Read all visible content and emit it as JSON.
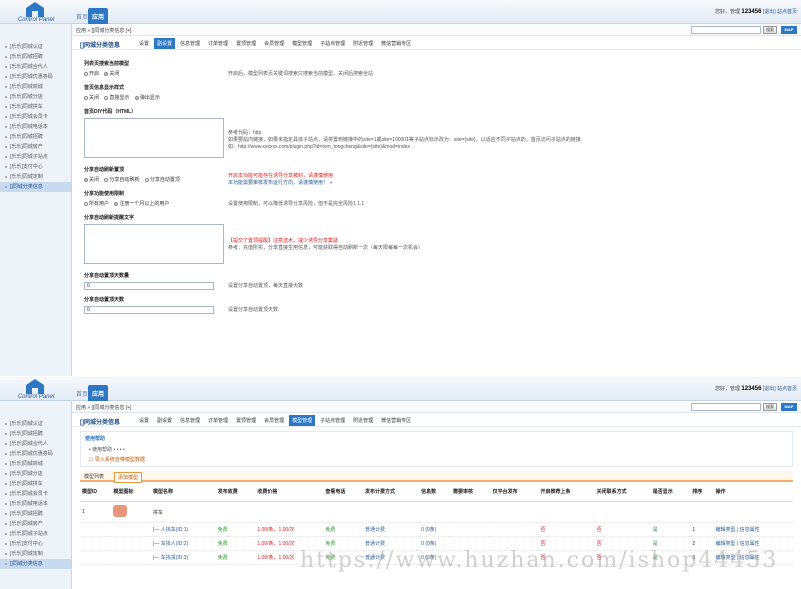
{
  "header": {
    "logo_text": "Control Panel",
    "tabs": [
      "首页",
      "应用"
    ],
    "user_prefix": "您好，管理",
    "user_name": "123456",
    "logout": "[退出]",
    "site_home": "站点首页"
  },
  "sidebar": {
    "items": [
      "[乐乐]同城认证",
      "[乐乐]同城招聘",
      "[乐乐]同城合代人",
      "[乐乐]同城优惠劵码",
      "[乐乐]同城商城",
      "[乐乐]同城分店",
      "[乐乐]同城拼车",
      "[乐乐]同城会员卡",
      "[乐乐]同城电话本",
      "[乐乐]同城招聘",
      "[乐乐]同城房产",
      "[乐乐]同城子站点",
      "[乐乐]支付中心",
      "[乐乐]同城定制",
      "[]同城分类信息"
    ],
    "active_index": 14
  },
  "breadcrumb": "应用 » []同城分类信息 [+]",
  "search": {
    "button": "搜索",
    "map": "MAP"
  },
  "subnav": {
    "title": "[]同城分类信息",
    "items": [
      "设置",
      "副设置",
      "信息管理",
      "订单管理",
      "置顶管理",
      "会员管理",
      "模型管理",
      "子站点管理",
      "附近管理",
      "微信营销专区"
    ]
  },
  "panel1": {
    "subnav_active": 1,
    "fields": [
      {
        "label": "列表页搜索当前模型",
        "options": [
          "开启",
          "关闭"
        ],
        "selected": 1,
        "tip": "开启后，模型列表页关键词搜索只搜索当前模型，关闭后搜索全站"
      },
      {
        "label": "首页信息显示样式",
        "options": [
          "关闭",
          "直接显示",
          "弹出显示"
        ],
        "selected": 2
      }
    ],
    "diy_label": "首页DIY代码（HTML）",
    "diy_tips": [
      "参考代码：http",
      "如果要站内链接，如果未指定具体子站点，请将置到链接中的site=1或site=100001等子站点标示改为：site={site}，以适应不同子站点的，首页访问子站点的链接",
      "如：http://www.xxxxxx.com/plugin.php?id=tom_tongcheng&site={site}&mod=index"
    ],
    "share_label": "分享自动刷新置顶",
    "share_options": [
      "关闭",
      "分享自动刷新",
      "分享自动置顶"
    ],
    "share_selected": 0,
    "share_tip_red": "开启本功能可能存在诱导分享被封，请谨慎使用",
    "share_tip_blue": "本功能需要审核发布运行方向，请谨慎使用！ »",
    "limit_label": "分享功能使用限制",
    "limit_options": [
      "所有用户",
      "注册一个月以上的用户"
    ],
    "limit_selected": 1,
    "limit_tip": "设置使用限制，可以降低诱导分享风险，但不是完全风险1.1.1",
    "remind_label": "分享自动刷新提醒文字",
    "remind_tip_red": "【提交了置顶提醒】注意送术，减少诱导分享集疑",
    "remind_tip": "参考：充值所实，分享直接生用信息，可能获取得自动刷新一次（每天限每每一次机会）",
    "count_label": "分享自动置顶天数量",
    "count_value": "0",
    "count_tip": "设置分享自动置顶，每天直接大数",
    "days_label": "分享自动置顶天数",
    "days_value": "0",
    "days_tip": "设置分享自动置顶天数"
  },
  "panel2": {
    "subnav_active": 6,
    "help_title": "使用帮助",
    "help_item": "• 使用帮助 • • • •",
    "help_add": "☐ 导入系统自带模型数据",
    "list_tab": "模型列表",
    "add_btn": "添加模型",
    "columns": [
      "模型ID",
      "模型图标",
      "模型名称",
      "发布收费",
      "收费价格",
      "查看电话",
      "发布计费方式",
      "信息数",
      "需要审核",
      "仅平台发布",
      "开启推荐上条",
      "关闭联系方式",
      "是否显示",
      "排序",
      "操作"
    ],
    "rows": [
      {
        "id": "1",
        "name": "拼车"
      },
      {
        "name": "|— 人找车(ID:1)",
        "fee": "免费",
        "price": "1.00/条，1.00/次",
        "phone": "免费",
        "billing": "普通计费",
        "count": "0 (0条)",
        "rec": "否",
        "close": "否",
        "show": "是",
        "sort": "1",
        "op": "编辑类型 | 信息属性"
      },
      {
        "name": "|— 车找人(ID:2)",
        "fee": "免费",
        "price": "1.00/条，1.00/次",
        "phone": "免费",
        "billing": "普通计费",
        "count": "0 (0条)",
        "rec": "否",
        "close": "否",
        "show": "是",
        "sort": "2",
        "op": "编辑类型 | 信息属性"
      },
      {
        "name": "|— 车找货(ID:3)",
        "fee": "免费",
        "price": "1.00/条，1.00/次",
        "phone": "免费",
        "billing": "普通计费",
        "count": "0 (0条)",
        "rec": "否",
        "close": "否",
        "show": "是",
        "sort": "3",
        "op": "编辑类型 | 信息属性"
      }
    ]
  },
  "watermark": "https://www.huzhan.com/ishop44453"
}
